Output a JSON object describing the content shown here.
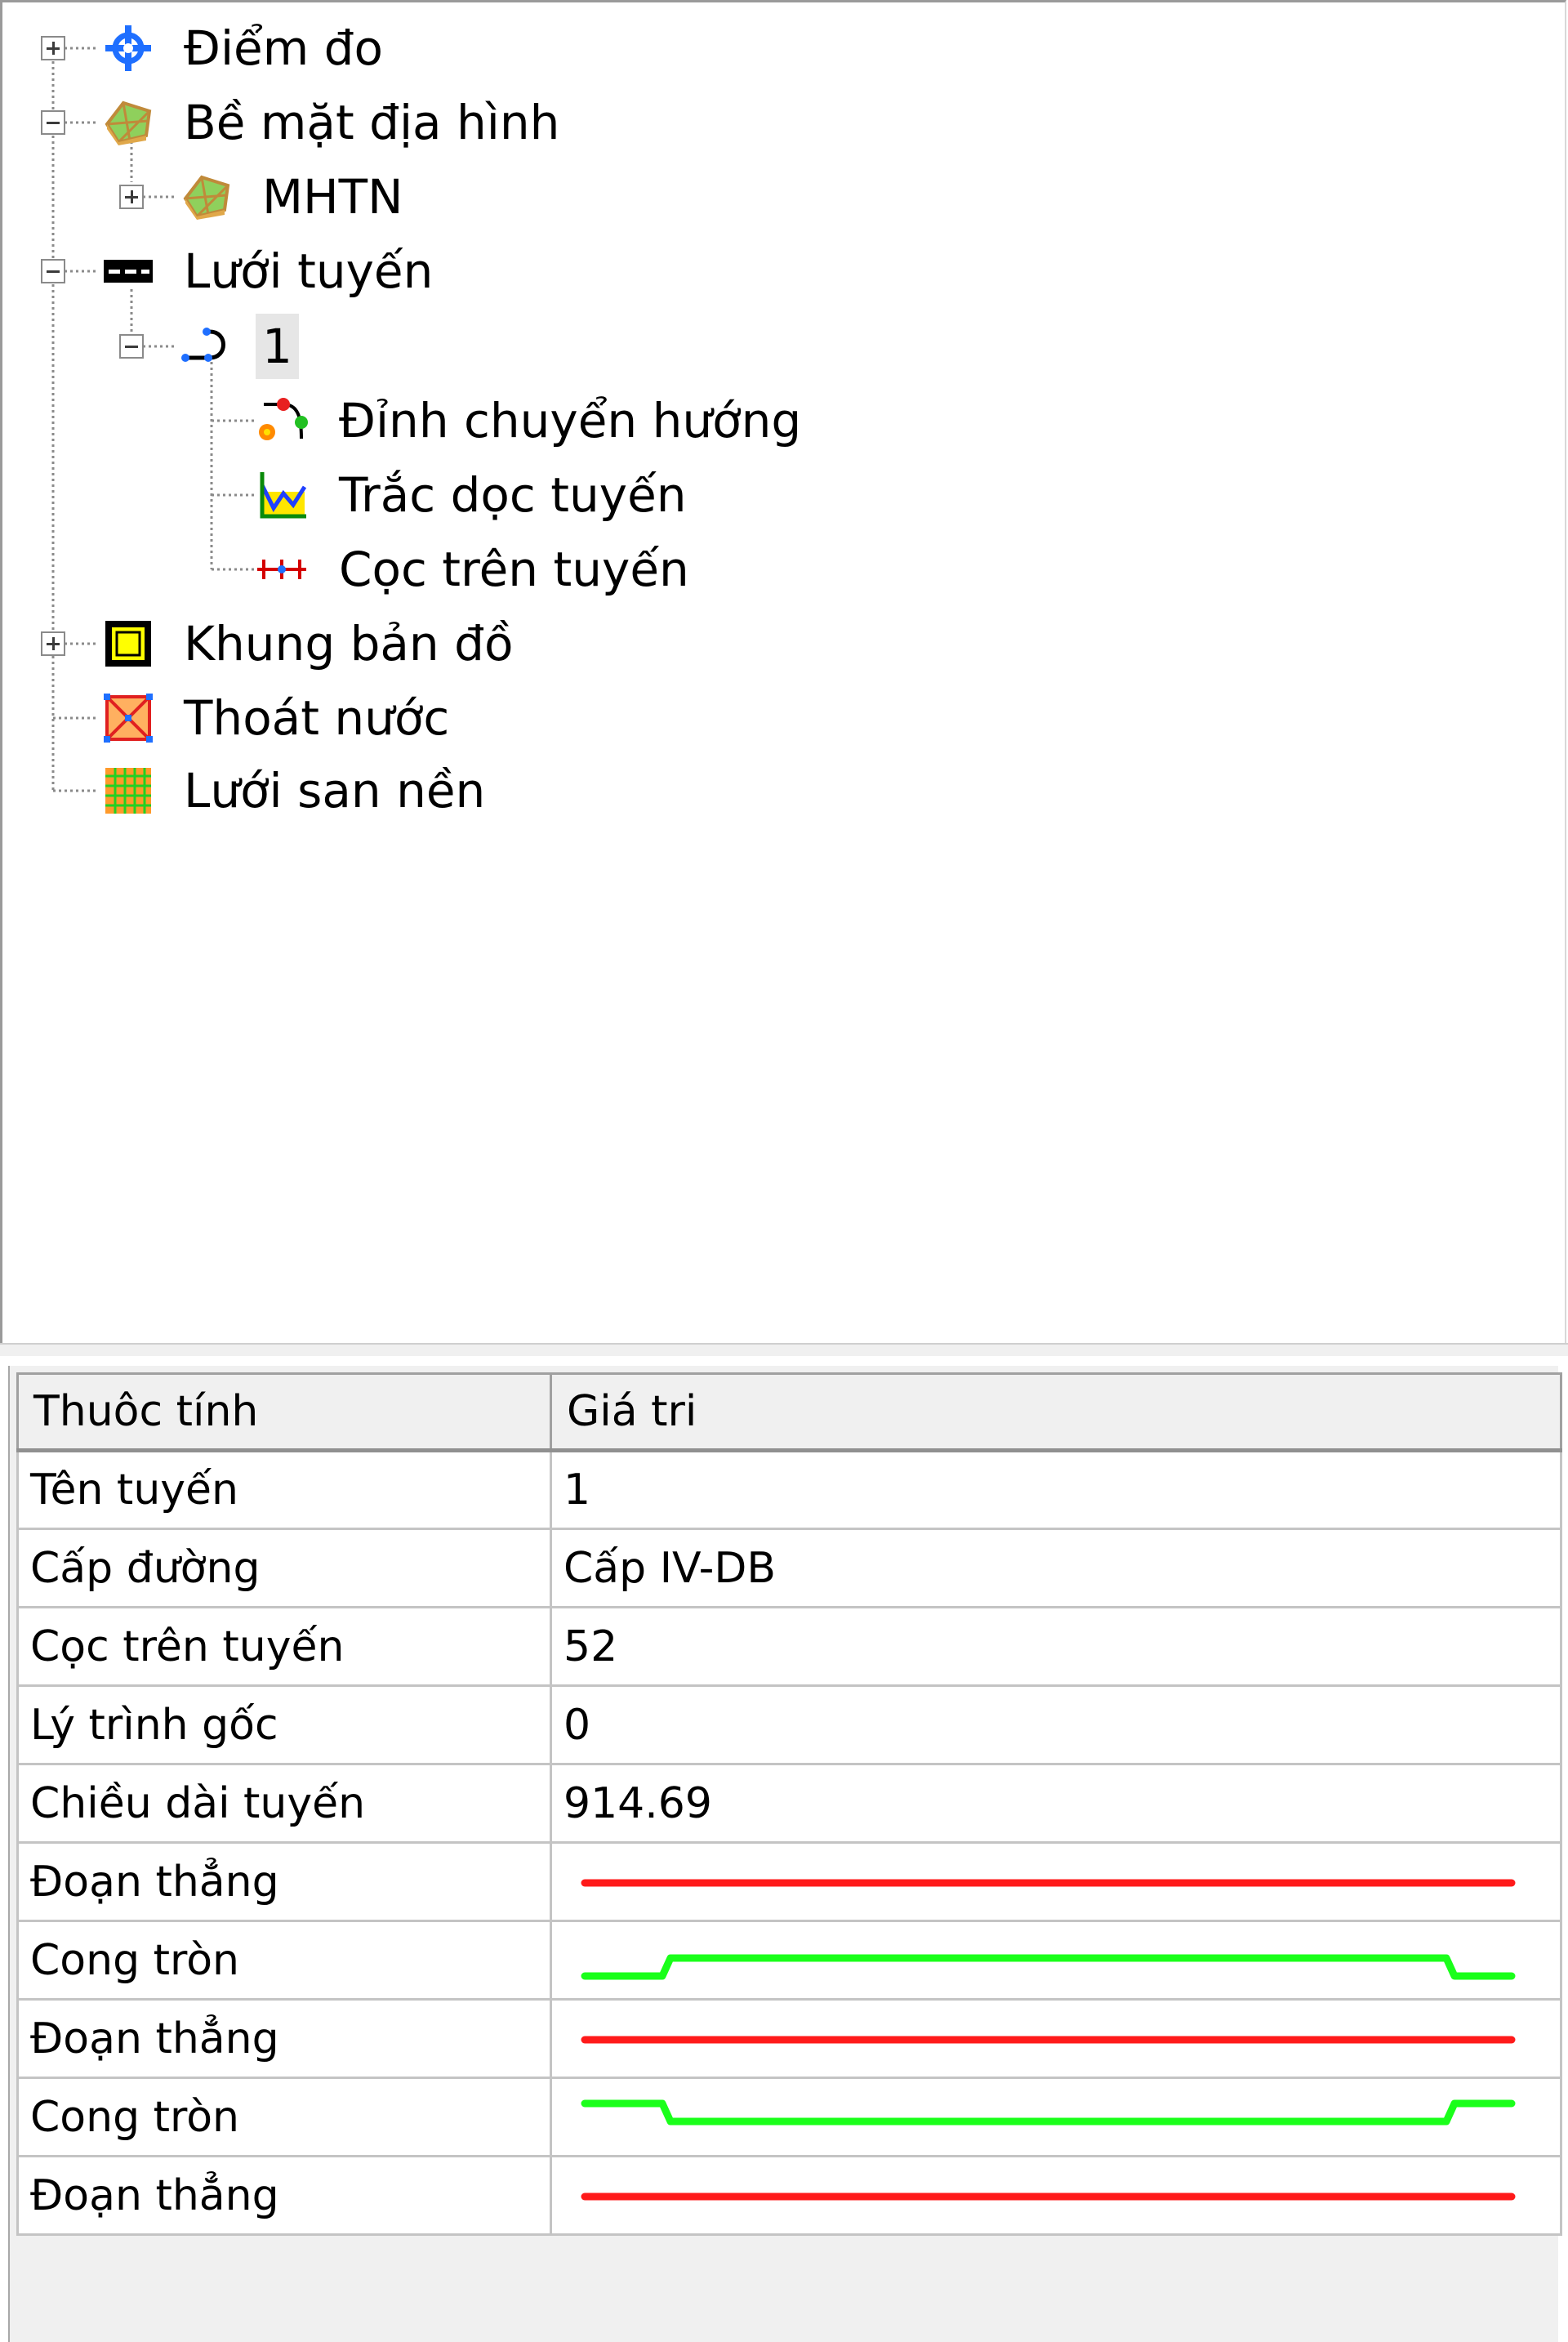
{
  "tree": {
    "nodes": [
      {
        "label": "Điểm đo",
        "icon": "survey-point-icon",
        "expander": "plus"
      },
      {
        "label": "Bề mặt địa hình",
        "icon": "terrain-surface-icon",
        "expander": "minus"
      },
      {
        "label": "MHTN",
        "icon": "terrain-surface-icon",
        "expander": "plus"
      },
      {
        "label": "Lưới tuyến",
        "icon": "route-network-icon",
        "expander": "minus"
      },
      {
        "label": "1",
        "icon": "route-alignment-icon",
        "expander": "minus",
        "selected": true
      },
      {
        "label": "Đỉnh chuyển hướng",
        "icon": "turning-point-icon"
      },
      {
        "label": "Trắc dọc tuyến",
        "icon": "profile-chart-icon"
      },
      {
        "label": "Cọc trên tuyến",
        "icon": "stations-icon"
      },
      {
        "label": "Khung bản đồ",
        "icon": "map-frame-icon",
        "expander": "plus"
      },
      {
        "label": "Thoát nước",
        "icon": "drainage-icon"
      },
      {
        "label": "Lưới san nền",
        "icon": "grading-grid-icon"
      }
    ]
  },
  "properties": {
    "headers": [
      "Thuôc tính",
      "Giá tri"
    ],
    "rows": [
      {
        "name": "Tên tuyến",
        "value": "1"
      },
      {
        "name": "Cấp đường",
        "value": "Cấp IV-DB"
      },
      {
        "name": "Cọc trên tuyến",
        "value": "52"
      },
      {
        "name": "Lý trình gốc",
        "value": "0"
      },
      {
        "name": "Chiều dài tuyến",
        "value": "914.69"
      },
      {
        "name": "Đoạn thẳng",
        "graphic": "straight",
        "color": "#ff1a1a"
      },
      {
        "name": "Cong tròn",
        "graphic": "curve-up",
        "color": "#1aff1a"
      },
      {
        "name": "Đoạn thẳng",
        "graphic": "straight",
        "color": "#ff1a1a"
      },
      {
        "name": "Cong tròn",
        "graphic": "curve-down",
        "color": "#1aff1a"
      },
      {
        "name": "Đoạn thẳng",
        "graphic": "straight",
        "color": "#ff1a1a"
      }
    ]
  }
}
